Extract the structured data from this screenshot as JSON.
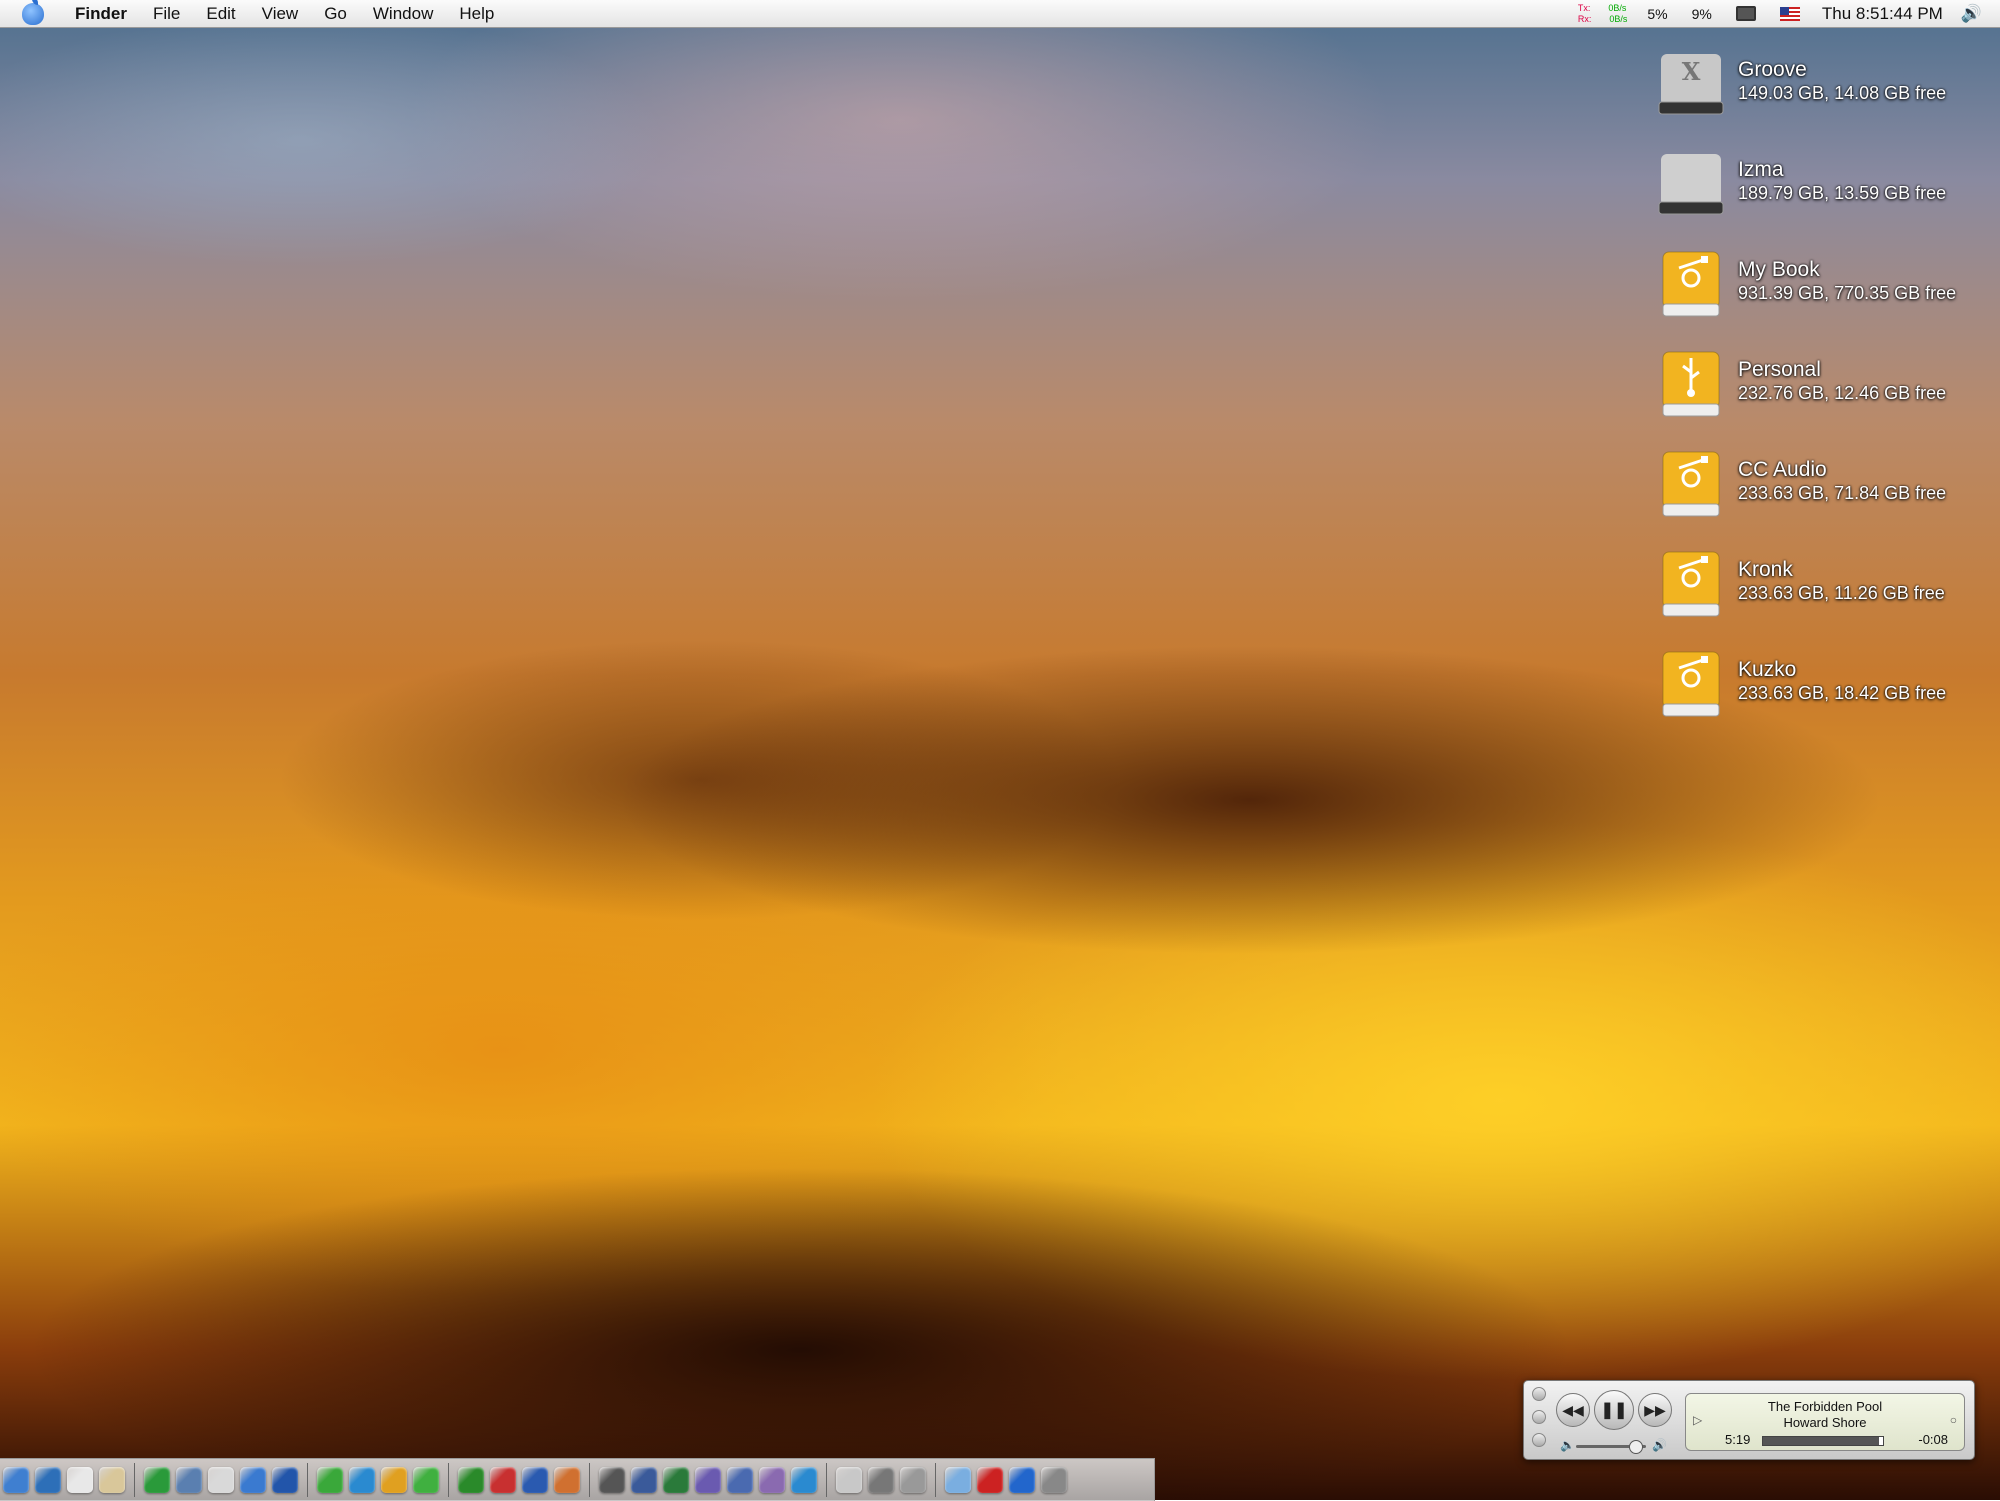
{
  "menubar": {
    "app_name": "Finder",
    "menus": [
      "File",
      "Edit",
      "View",
      "Go",
      "Window",
      "Help"
    ],
    "net_tx_label": "Tx:",
    "net_rx_label": "Rx:",
    "net_tx_value": "0B/s",
    "net_rx_value": "0B/s",
    "cpu_1": "5%",
    "cpu_2": "9%",
    "clock": "Thu 8:51:44 PM"
  },
  "drives": [
    {
      "name": "Groove",
      "info": "149.03 GB, 14.08 GB free",
      "icon": "internal-drive-x-icon",
      "color": "#c8c8c8"
    },
    {
      "name": "Izma",
      "info": "189.79 GB, 13.59 GB free",
      "icon": "internal-drive-icon",
      "color": "#cfcfcf"
    },
    {
      "name": "My Book",
      "info": "931.39 GB, 770.35 GB free",
      "icon": "firewire-drive-icon",
      "color": "#f2b420"
    },
    {
      "name": "Personal",
      "info": "232.76 GB, 12.46 GB free",
      "icon": "usb-drive-icon",
      "color": "#f2b420"
    },
    {
      "name": "CC Audio",
      "info": "233.63 GB, 71.84 GB free",
      "icon": "firewire-drive-icon",
      "color": "#f2b420"
    },
    {
      "name": "Kronk",
      "info": "233.63 GB, 11.26 GB free",
      "icon": "firewire-drive-icon",
      "color": "#f2b420"
    },
    {
      "name": "Kuzko",
      "info": "233.63 GB, 18.42 GB free",
      "icon": "firewire-drive-icon",
      "color": "#f2b420"
    }
  ],
  "player": {
    "title": "The Forbidden Pool",
    "artist": "Howard Shore",
    "elapsed": "5:19",
    "remaining": "-0:08",
    "progress": 0.97,
    "volume": 0.75
  },
  "dock": {
    "groups": [
      [
        "#3f7fd0",
        "#2d6fb8",
        "#e8e8e8",
        "#d9c79a"
      ],
      [
        "#2a9a3a",
        "#5a7fb0",
        "#d9d9d9",
        "#3a7ad0",
        "#2255aa"
      ],
      [
        "#3aa83a",
        "#2a8ad0",
        "#e0a020",
        "#40b040"
      ],
      [
        "#2a8a2a",
        "#c83030",
        "#2a5ab0",
        "#d07030"
      ],
      [
        "#555555",
        "#3a5a9a",
        "#2a7a3a",
        "#6a5ab0",
        "#4a6ab0",
        "#8a6ab0",
        "#2a8ad0"
      ],
      [
        "#c8c8c8",
        "#777777",
        "#999999"
      ],
      [
        "#7aaee0",
        "#cc2222",
        "#2266cc",
        "#888888"
      ]
    ]
  }
}
